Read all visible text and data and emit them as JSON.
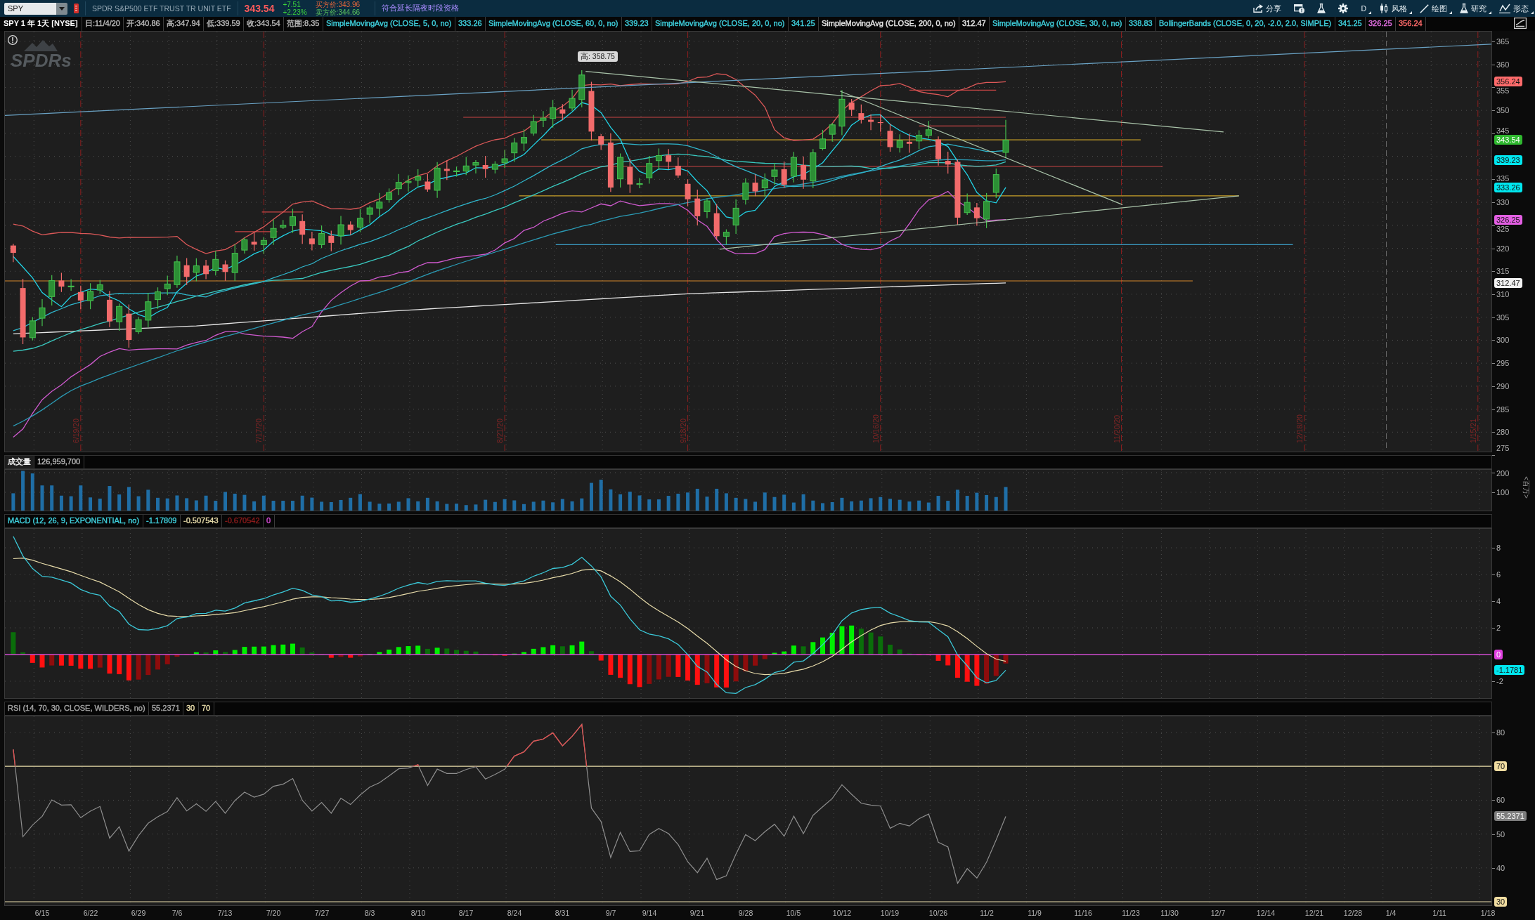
{
  "toolbar": {
    "symbol": "SPY",
    "description": "SPDR S&P500 ETF TRUST TR UNIT ETF",
    "last": "343.54",
    "change": "+7.51",
    "change_percent": "+2.23%",
    "bid": "买方价:343.96",
    "ask": "卖方价:344.66",
    "extended_hours": "符合延长隔夜时段资格",
    "buttons": [
      {
        "kind": "share",
        "label": "分享",
        "dropdown": false
      },
      {
        "kind": "window",
        "dropdown": false
      },
      {
        "kind": "lab",
        "dropdown": false
      },
      {
        "kind": "settings",
        "dropdown": false
      },
      {
        "kind": "period",
        "label": "D",
        "dropdown": true
      },
      {
        "kind": "style",
        "label": "风格",
        "dropdown": true
      },
      {
        "kind": "drawing",
        "label": "绘图",
        "dropdown": true
      },
      {
        "kind": "studies",
        "label": "研究",
        "dropdown": true
      },
      {
        "kind": "patterns",
        "label": "形态",
        "dropdown": true
      }
    ]
  },
  "legend": {
    "title": "SPY 1 年 1天 [NYSE]",
    "fields": [
      "日:11/4/20",
      "开:340.86",
      "高:347.94",
      "低:339.59",
      "收:343.54",
      "范围:8.35"
    ],
    "studies": [
      {
        "label": "SimpleMovingAvg (CLOSE, 5, 0, no)",
        "color": "#3fcfdc",
        "values": [
          {
            "text": "333.26",
            "color": "#3fcfdc"
          }
        ]
      },
      {
        "label": "SimpleMovingAvg (CLOSE, 60, 0, no)",
        "color": "#3fcfdc",
        "values": [
          {
            "text": "339.23",
            "color": "#3fcfdc"
          }
        ]
      },
      {
        "label": "SimpleMovingAvg (CLOSE, 20, 0, no)",
        "color": "#3fcfdc",
        "values": [
          {
            "text": "341.25",
            "color": "#3fcfdc"
          }
        ]
      },
      {
        "label": "SimpleMovingAvg (CLOSE, 200, 0, no)",
        "color": "#e8e8e8",
        "values": [
          {
            "text": "312.47",
            "color": "#e8e8e8"
          }
        ]
      },
      {
        "label": "SimpleMovingAvg (CLOSE, 30, 0, no)",
        "color": "#3fcfdc",
        "values": [
          {
            "text": "338.83",
            "color": "#3fcfdc"
          }
        ]
      },
      {
        "label": "BollingerBands (CLOSE, 0, 20, -2.0, 2.0, SIMPLE)",
        "color": "#3fcfdc",
        "values": [
          {
            "text": "341.25",
            "color": "#3fcfdc"
          },
          {
            "text": "326.25",
            "color": "#e36fe3"
          },
          {
            "text": "356.24",
            "color": "#ff6b6b"
          }
        ]
      }
    ]
  },
  "price_pane": {
    "logo": "SPDRs",
    "high_label": "高: 358.75",
    "expirations": [
      "6/19/20",
      "7/17/20",
      "8/21/20",
      "9/18/20",
      "10/16/20",
      "11/20/20",
      "12/18/20",
      "1/15/21"
    ],
    "y_ticks": [
      "365",
      "360",
      "355",
      "350",
      "345",
      "335",
      "330",
      "325",
      "320",
      "315",
      "310",
      "305",
      "300",
      "295",
      "290",
      "285",
      "280",
      "275"
    ],
    "markers": [
      {
        "text": "356.24",
        "color": "#ff6b6b"
      },
      {
        "text": "343.54",
        "color": "#2fb82f"
      },
      {
        "text": "339.23",
        "color": "#00e6ee"
      },
      {
        "text": "333.26",
        "color": "#00e6ee"
      },
      {
        "text": "326.25",
        "color": "#e35fe3"
      },
      {
        "text": "312.47",
        "color": "#f2f2f2"
      }
    ]
  },
  "volume_pane": {
    "title": "成交量",
    "value": "126,959,700",
    "y_ticks": [
      "200",
      "100"
    ],
    "unit": "<百万>"
  },
  "macd_pane": {
    "legend": [
      {
        "text": "MACD (12, 26, 9, EXPONENTIAL, no)",
        "color": "#3fcfdc"
      },
      {
        "text": "-1.17809",
        "color": "#3fcfdc"
      },
      {
        "text": "-0.507543",
        "color": "#e8dcaa"
      },
      {
        "text": "-0.670542",
        "color": "#8c1c1c"
      },
      {
        "text": "0",
        "color": "#d84cd8"
      }
    ],
    "y_ticks": [
      "8",
      "6",
      "4",
      "2",
      "-2"
    ],
    "markers": [
      {
        "text": "0",
        "color": "#e040e0"
      },
      {
        "text": "-1.1781",
        "color": "#00e6ee"
      }
    ]
  },
  "rsi_pane": {
    "legend": [
      {
        "text": "RSI (14, 70, 30, CLOSE, WILDERS, no)",
        "color": "#a4a4a4"
      },
      {
        "text": "55.2371",
        "color": "#a4a4a4"
      },
      {
        "text": "30",
        "color": "#e8dcaa"
      },
      {
        "text": "70",
        "color": "#e8dcaa"
      }
    ],
    "y_ticks": [
      "80",
      "60",
      "50",
      "40"
    ],
    "markers": [
      {
        "text": "70",
        "color": "#f0dca0"
      },
      {
        "text": "55.2371",
        "color": "#7d7d7d"
      },
      {
        "text": "30",
        "color": "#f0dca0"
      }
    ]
  },
  "x_axis": [
    "6/15",
    "6/22",
    "6/29",
    "7/6",
    "7/13",
    "7/20",
    "7/27",
    "8/3",
    "8/10",
    "8/17",
    "8/24",
    "8/31",
    "9/7",
    "9/14",
    "9/21",
    "9/28",
    "10/5",
    "10/12",
    "10/19",
    "10/26",
    "11/2",
    "11/9",
    "11/16",
    "11/23",
    "11/30",
    "12/7",
    "12/14",
    "12/21",
    "12/28",
    "1/4",
    "1/11",
    "1/18"
  ]
}
